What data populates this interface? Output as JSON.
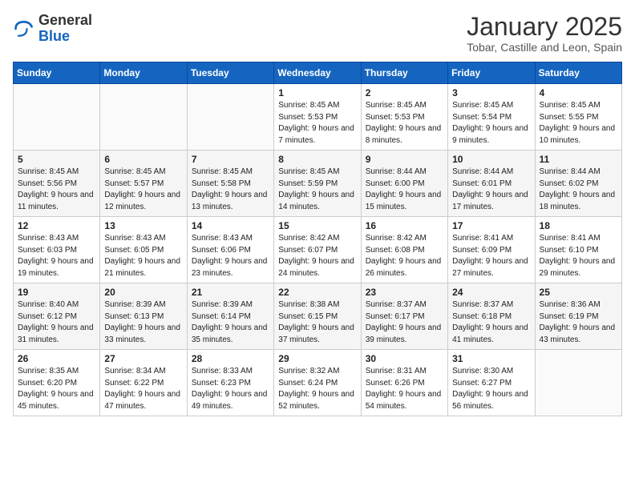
{
  "header": {
    "logo_general": "General",
    "logo_blue": "Blue",
    "month": "January 2025",
    "location": "Tobar, Castille and Leon, Spain"
  },
  "weekdays": [
    "Sunday",
    "Monday",
    "Tuesday",
    "Wednesday",
    "Thursday",
    "Friday",
    "Saturday"
  ],
  "weeks": [
    [
      {
        "day": "",
        "info": ""
      },
      {
        "day": "",
        "info": ""
      },
      {
        "day": "",
        "info": ""
      },
      {
        "day": "1",
        "info": "Sunrise: 8:45 AM\nSunset: 5:53 PM\nDaylight: 9 hours\nand 7 minutes."
      },
      {
        "day": "2",
        "info": "Sunrise: 8:45 AM\nSunset: 5:53 PM\nDaylight: 9 hours\nand 8 minutes."
      },
      {
        "day": "3",
        "info": "Sunrise: 8:45 AM\nSunset: 5:54 PM\nDaylight: 9 hours\nand 9 minutes."
      },
      {
        "day": "4",
        "info": "Sunrise: 8:45 AM\nSunset: 5:55 PM\nDaylight: 9 hours\nand 10 minutes."
      }
    ],
    [
      {
        "day": "5",
        "info": "Sunrise: 8:45 AM\nSunset: 5:56 PM\nDaylight: 9 hours\nand 11 minutes."
      },
      {
        "day": "6",
        "info": "Sunrise: 8:45 AM\nSunset: 5:57 PM\nDaylight: 9 hours\nand 12 minutes."
      },
      {
        "day": "7",
        "info": "Sunrise: 8:45 AM\nSunset: 5:58 PM\nDaylight: 9 hours\nand 13 minutes."
      },
      {
        "day": "8",
        "info": "Sunrise: 8:45 AM\nSunset: 5:59 PM\nDaylight: 9 hours\nand 14 minutes."
      },
      {
        "day": "9",
        "info": "Sunrise: 8:44 AM\nSunset: 6:00 PM\nDaylight: 9 hours\nand 15 minutes."
      },
      {
        "day": "10",
        "info": "Sunrise: 8:44 AM\nSunset: 6:01 PM\nDaylight: 9 hours\nand 17 minutes."
      },
      {
        "day": "11",
        "info": "Sunrise: 8:44 AM\nSunset: 6:02 PM\nDaylight: 9 hours\nand 18 minutes."
      }
    ],
    [
      {
        "day": "12",
        "info": "Sunrise: 8:43 AM\nSunset: 6:03 PM\nDaylight: 9 hours\nand 19 minutes."
      },
      {
        "day": "13",
        "info": "Sunrise: 8:43 AM\nSunset: 6:05 PM\nDaylight: 9 hours\nand 21 minutes."
      },
      {
        "day": "14",
        "info": "Sunrise: 8:43 AM\nSunset: 6:06 PM\nDaylight: 9 hours\nand 23 minutes."
      },
      {
        "day": "15",
        "info": "Sunrise: 8:42 AM\nSunset: 6:07 PM\nDaylight: 9 hours\nand 24 minutes."
      },
      {
        "day": "16",
        "info": "Sunrise: 8:42 AM\nSunset: 6:08 PM\nDaylight: 9 hours\nand 26 minutes."
      },
      {
        "day": "17",
        "info": "Sunrise: 8:41 AM\nSunset: 6:09 PM\nDaylight: 9 hours\nand 27 minutes."
      },
      {
        "day": "18",
        "info": "Sunrise: 8:41 AM\nSunset: 6:10 PM\nDaylight: 9 hours\nand 29 minutes."
      }
    ],
    [
      {
        "day": "19",
        "info": "Sunrise: 8:40 AM\nSunset: 6:12 PM\nDaylight: 9 hours\nand 31 minutes."
      },
      {
        "day": "20",
        "info": "Sunrise: 8:39 AM\nSunset: 6:13 PM\nDaylight: 9 hours\nand 33 minutes."
      },
      {
        "day": "21",
        "info": "Sunrise: 8:39 AM\nSunset: 6:14 PM\nDaylight: 9 hours\nand 35 minutes."
      },
      {
        "day": "22",
        "info": "Sunrise: 8:38 AM\nSunset: 6:15 PM\nDaylight: 9 hours\nand 37 minutes."
      },
      {
        "day": "23",
        "info": "Sunrise: 8:37 AM\nSunset: 6:17 PM\nDaylight: 9 hours\nand 39 minutes."
      },
      {
        "day": "24",
        "info": "Sunrise: 8:37 AM\nSunset: 6:18 PM\nDaylight: 9 hours\nand 41 minutes."
      },
      {
        "day": "25",
        "info": "Sunrise: 8:36 AM\nSunset: 6:19 PM\nDaylight: 9 hours\nand 43 minutes."
      }
    ],
    [
      {
        "day": "26",
        "info": "Sunrise: 8:35 AM\nSunset: 6:20 PM\nDaylight: 9 hours\nand 45 minutes."
      },
      {
        "day": "27",
        "info": "Sunrise: 8:34 AM\nSunset: 6:22 PM\nDaylight: 9 hours\nand 47 minutes."
      },
      {
        "day": "28",
        "info": "Sunrise: 8:33 AM\nSunset: 6:23 PM\nDaylight: 9 hours\nand 49 minutes."
      },
      {
        "day": "29",
        "info": "Sunrise: 8:32 AM\nSunset: 6:24 PM\nDaylight: 9 hours\nand 52 minutes."
      },
      {
        "day": "30",
        "info": "Sunrise: 8:31 AM\nSunset: 6:26 PM\nDaylight: 9 hours\nand 54 minutes."
      },
      {
        "day": "31",
        "info": "Sunrise: 8:30 AM\nSunset: 6:27 PM\nDaylight: 9 hours\nand 56 minutes."
      },
      {
        "day": "",
        "info": ""
      }
    ]
  ]
}
